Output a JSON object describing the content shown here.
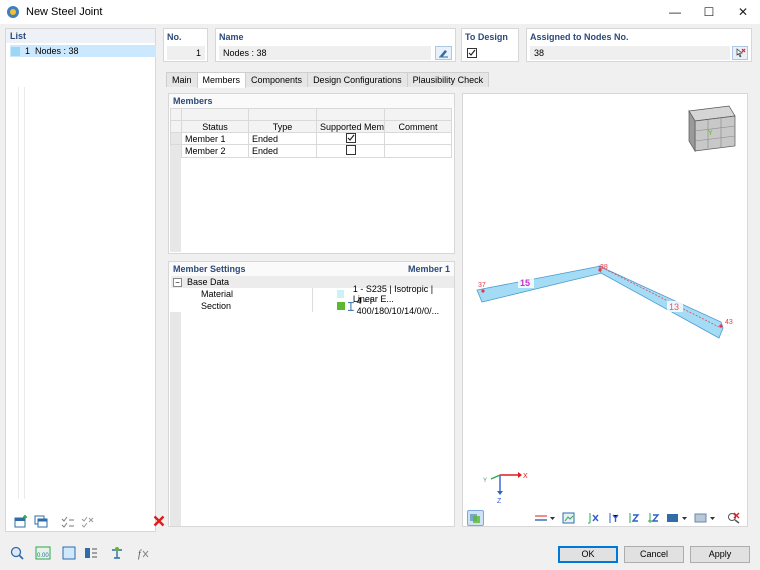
{
  "window": {
    "title": "New Steel Joint",
    "minimize": "—",
    "maximize": "☐",
    "close": "✕"
  },
  "list": {
    "header": "List",
    "items": [
      {
        "number": "1",
        "label": "Nodes : 38"
      }
    ]
  },
  "fields": {
    "no": {
      "label": "No.",
      "value": "1"
    },
    "name": {
      "label": "Name",
      "value": "Nodes : 38"
    },
    "to_design": {
      "label": "To Design",
      "checked": true
    },
    "assigned": {
      "label": "Assigned to Nodes No.",
      "value": "38"
    }
  },
  "tabs": [
    "Main",
    "Members",
    "Components",
    "Design Configurations",
    "Plausibility Check"
  ],
  "active_tab": "Members",
  "members": {
    "header": "Members",
    "columns": [
      "Status",
      "Type",
      "Supported Member",
      "Comment"
    ],
    "rows": [
      {
        "status": "Member 1",
        "type": "Ended",
        "supported": true,
        "comment": ""
      },
      {
        "status": "Member 2",
        "type": "Ended",
        "supported": false,
        "comment": ""
      }
    ]
  },
  "member_settings": {
    "header": "Member Settings",
    "current": "Member 1",
    "group": "Base Data",
    "rows": [
      {
        "name": "Material",
        "value": "1 - S235 | Isotropic | Linear E...",
        "color": "#c9f3f7"
      },
      {
        "name": "Section",
        "value": "4 - I 400/180/10/14/0/0/...",
        "color": "#5cb82f"
      }
    ]
  },
  "view3d": {
    "node_labels": [
      "37",
      "38",
      "43"
    ],
    "member_labels": [
      "15",
      "13"
    ],
    "axis_labels": {
      "x": "X",
      "y": "Y",
      "z": "Z"
    },
    "cube_face_label": "Y",
    "member_color": "#a5dcf5",
    "member_edge": "#4a9bd0",
    "node_color": "#e33a4a",
    "label_15_color": "#c832c8",
    "label_13_color": "#e05a6a"
  },
  "buttons": {
    "ok": "OK",
    "cancel": "Cancel",
    "apply": "Apply"
  },
  "bottom_toolbar_icons": [
    "search-icon",
    "units-icon",
    "color-box-icon",
    "display-settings-icon",
    "model-icon",
    "formula-icon"
  ],
  "bottom_toolbar_units_text": "0.00"
}
